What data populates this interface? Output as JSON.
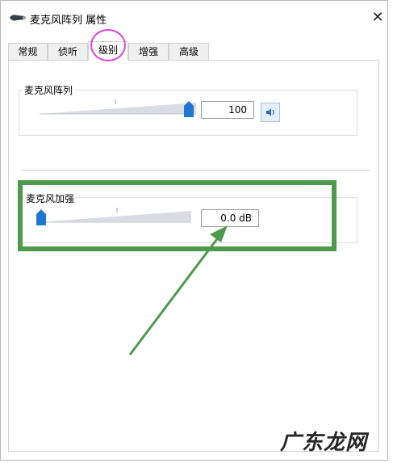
{
  "window": {
    "title": "麦克风阵列 属性",
    "close_symbol": "✕"
  },
  "tabs": [
    {
      "label": "常规",
      "active": false
    },
    {
      "label": "侦听",
      "active": false
    },
    {
      "label": "级别",
      "active": true
    },
    {
      "label": "增强",
      "active": false
    },
    {
      "label": "高级",
      "active": false
    }
  ],
  "level_group": {
    "label": "麦克风阵列",
    "value": "100",
    "slider_fraction": 1.0,
    "speaker_icon": "speaker-icon"
  },
  "boost_group": {
    "label": "麦克风加强",
    "value": "0.0 dB",
    "slider_fraction": 0.0
  },
  "colors": {
    "annotation_green": "#4e9a4c",
    "tab_highlight": "#e040d8",
    "slider_thumb": "#1e78d2"
  },
  "watermark": "广东龙网"
}
